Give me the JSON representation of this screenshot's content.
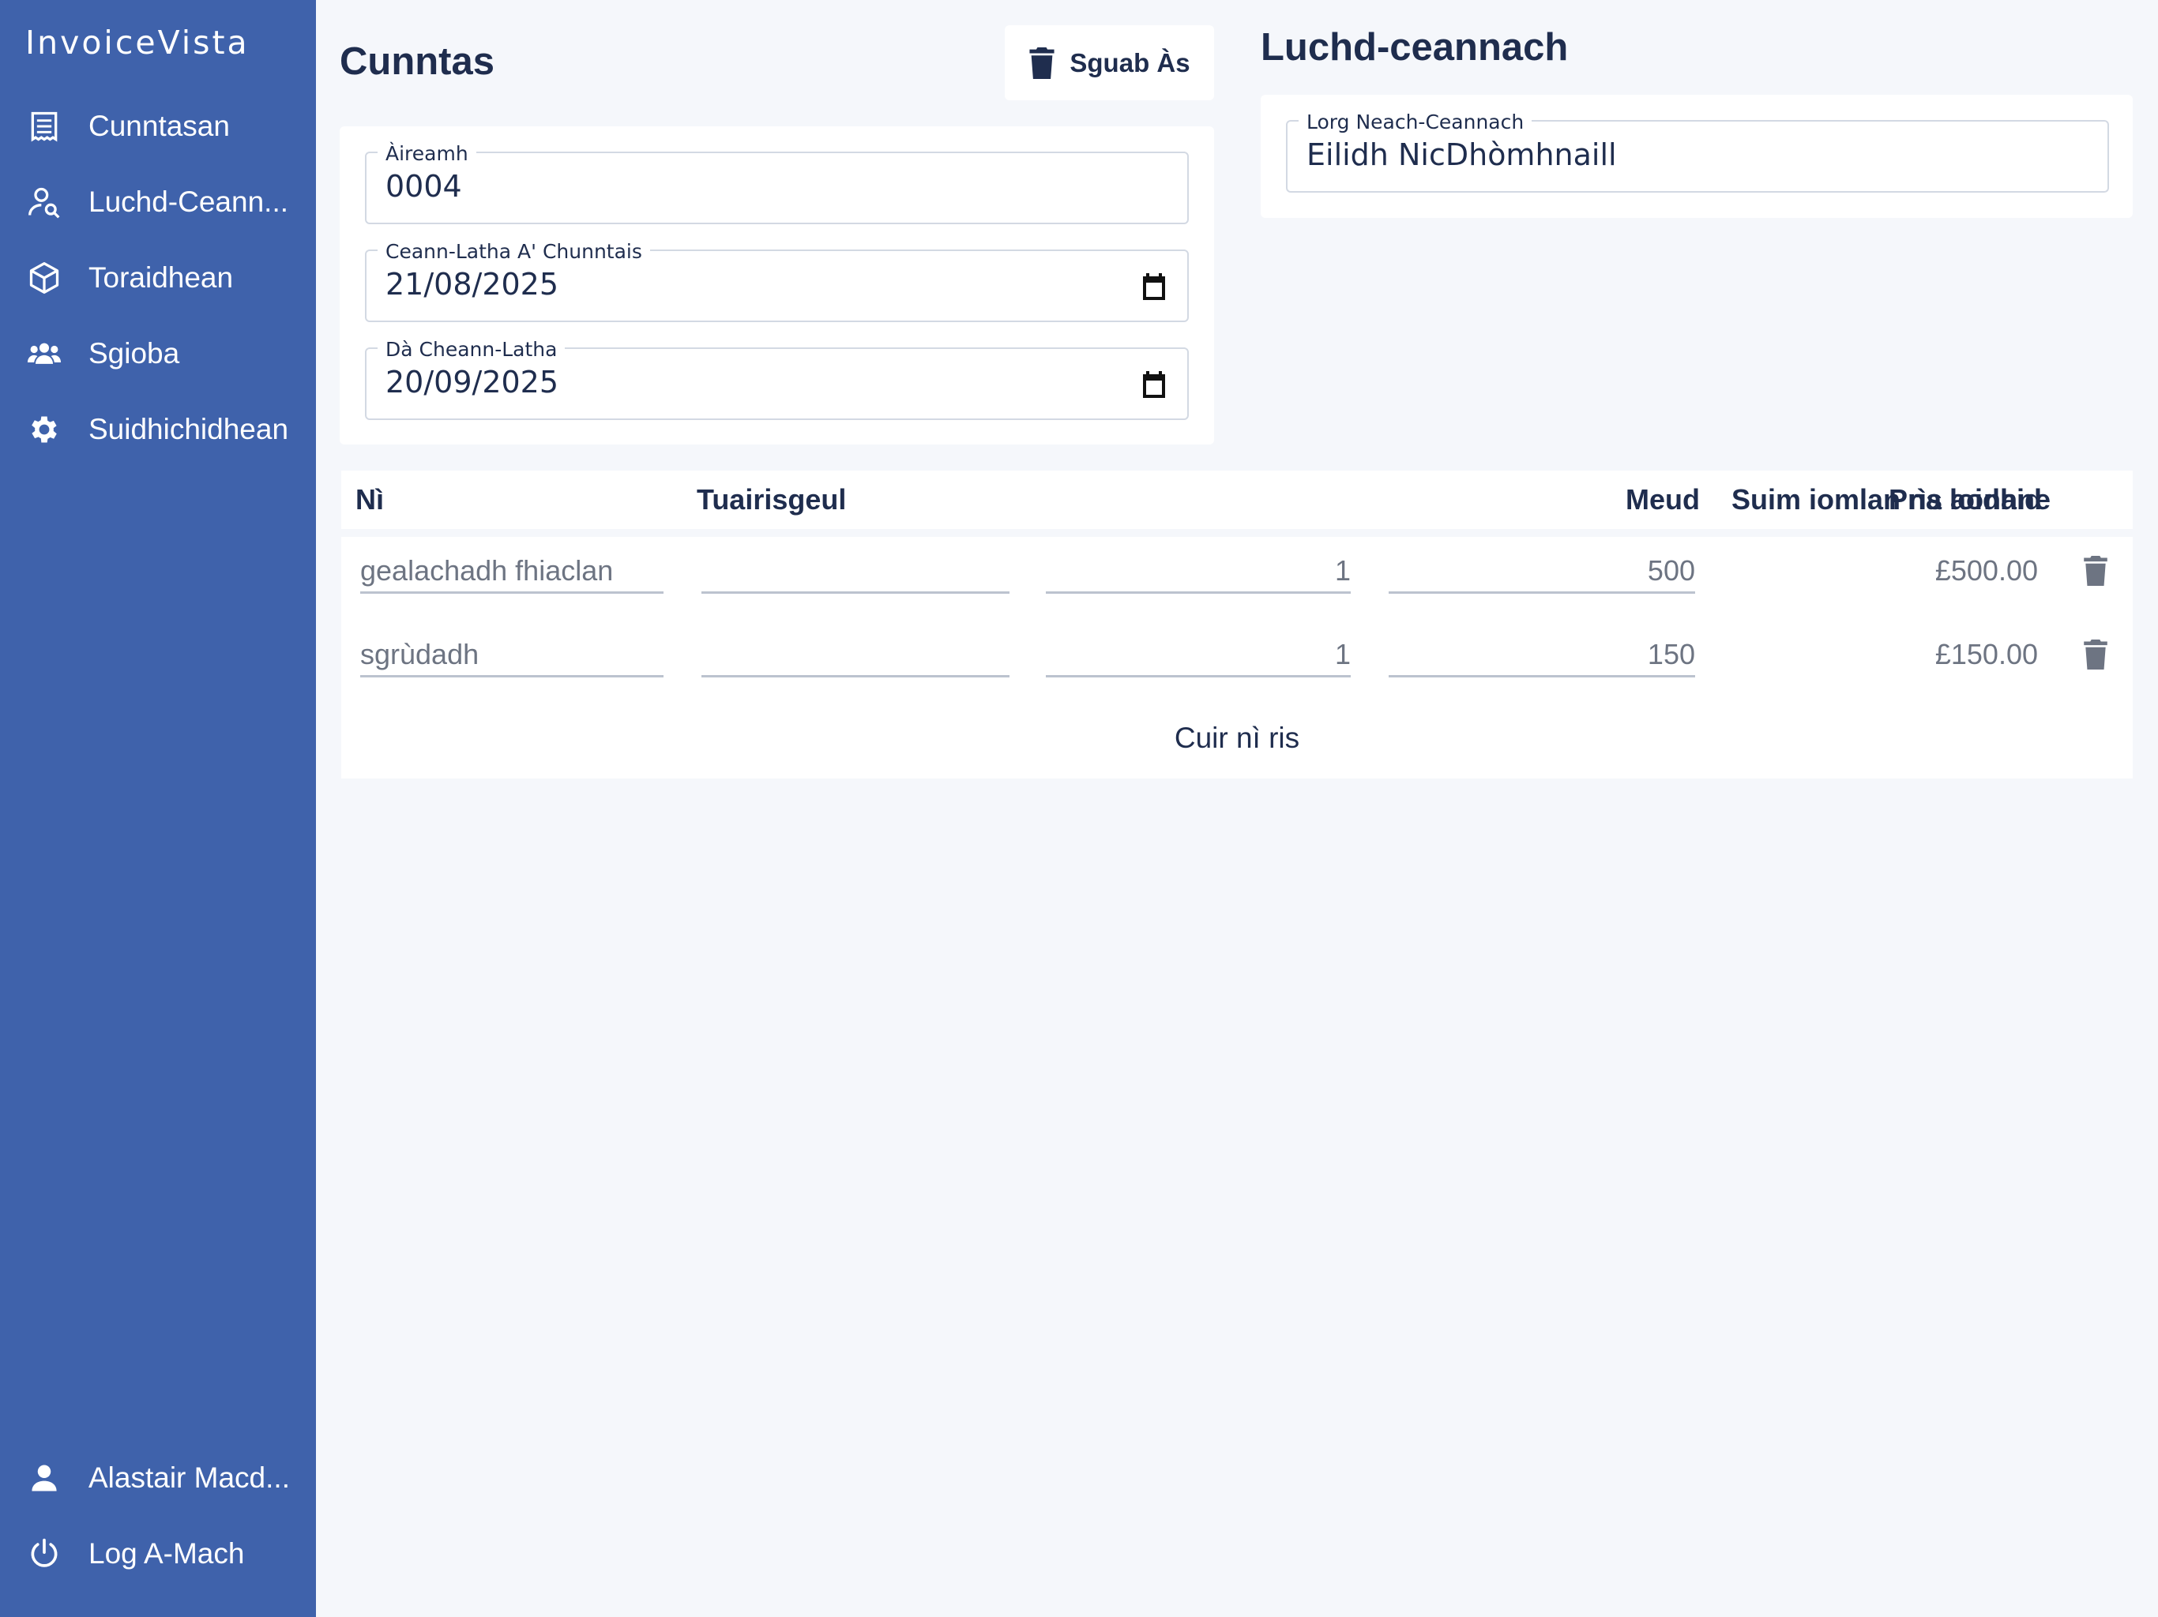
{
  "app": {
    "brand": "InvoiceVista"
  },
  "sidebar": {
    "items": [
      {
        "label": "Cunntasan",
        "icon": "receipt-icon"
      },
      {
        "label": "Luchd-Ceann...",
        "icon": "customer-search-icon"
      },
      {
        "label": "Toraidhean",
        "icon": "box-icon"
      },
      {
        "label": "Sgioba",
        "icon": "team-icon"
      },
      {
        "label": "Suidhichidhean",
        "icon": "gear-icon"
      }
    ],
    "user": {
      "label": "Alastair Macd...",
      "icon": "user-icon"
    },
    "logout": {
      "label": "Log A-Mach",
      "icon": "power-icon"
    }
  },
  "invoice": {
    "title": "Cunntas",
    "delete_label": "Sguab Às",
    "number_label": "Àireamh",
    "number_value": "0004",
    "date_label": "Ceann-Latha A' Chunntais",
    "date_value": "21/08/2025",
    "due_label": "Dà Cheann-Latha",
    "due_value": "20/09/2025"
  },
  "customer": {
    "title": "Luchd-ceannach",
    "search_label": "Lorg Neach-Ceannach",
    "search_value": "Eilidh NicDhòmhnaill"
  },
  "items_table": {
    "headers": {
      "item": "Nì",
      "description": "Tuairisgeul",
      "quantity": "Meud",
      "unit_price": "Prìs aonaid",
      "line_total": "Suim iomlan na loidhne"
    },
    "rows": [
      {
        "item": "gealachadh fhiaclan",
        "description": "",
        "quantity": "1",
        "unit_price": "500",
        "total": "£500.00"
      },
      {
        "item": "sgrùdadh",
        "description": "",
        "quantity": "1",
        "unit_price": "150",
        "total": "£150.00"
      }
    ],
    "add_item_label": "Cuir nì ris"
  },
  "colors": {
    "sidebar": "#3f62ab",
    "background": "#f5f7fb",
    "text": "#1f2d4e",
    "muted": "#6d7482"
  }
}
